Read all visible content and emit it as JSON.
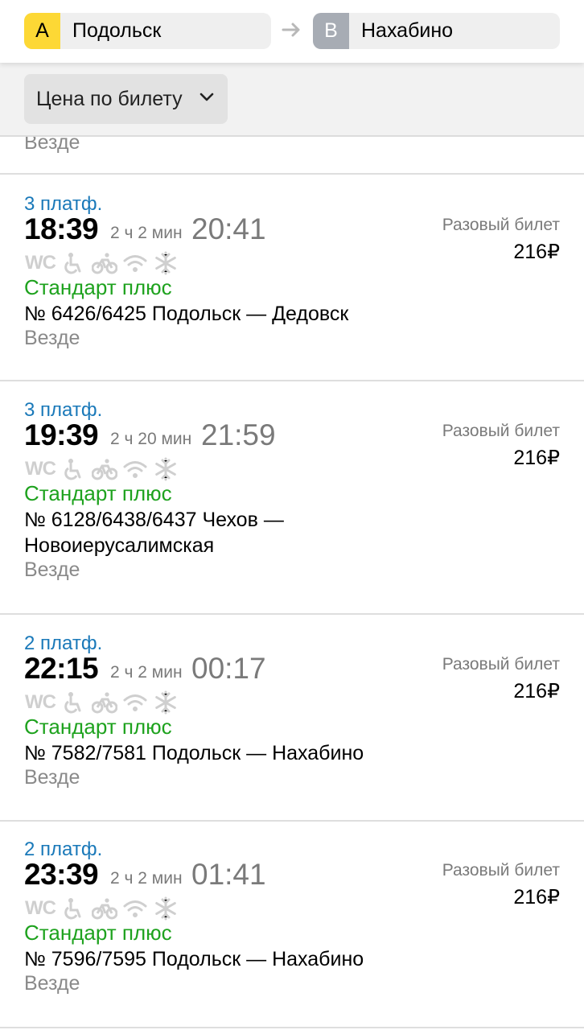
{
  "route": {
    "from_badge": "A",
    "from": "Подольск",
    "to_badge": "B",
    "to": "Нахабино"
  },
  "filter": {
    "label": "Цена по билету"
  },
  "prev_days": "Везде",
  "trips": [
    {
      "platform": "3 платф.",
      "departure": "18:39",
      "duration": "2 ч 2 мин",
      "arrival": "20:41",
      "wc": "WC",
      "class": "Стандарт плюс",
      "route": "№ 6426/6425 Подольск — Дедовск",
      "days": "Везде",
      "ticket": "Разовый билет",
      "price": "216₽"
    },
    {
      "platform": "3 платф.",
      "departure": "19:39",
      "duration": "2 ч 20 мин",
      "arrival": "21:59",
      "wc": "WC",
      "class": "Стандарт плюс",
      "route": "№ 6128/6438/6437 Чехов — Новоиерусалимская",
      "days": "Везде",
      "ticket": "Разовый билет",
      "price": "216₽"
    },
    {
      "platform": "2 платф.",
      "departure": "22:15",
      "duration": "2 ч 2 мин",
      "arrival": "00:17",
      "wc": "WC",
      "class": "Стандарт плюс",
      "route": "№ 7582/7581 Подольск — Нахабино",
      "days": "Везде",
      "ticket": "Разовый билет",
      "price": "216₽"
    },
    {
      "platform": "2 платф.",
      "departure": "23:39",
      "duration": "2 ч 2 мин",
      "arrival": "01:41",
      "wc": "WC",
      "class": "Стандарт плюс",
      "route": "№ 7596/7595 Подольск — Нахабино",
      "days": "Везде",
      "ticket": "Разовый билет",
      "price": "216₽"
    }
  ],
  "colors": {
    "platform": "#1a79b9",
    "class": "#1ea21e",
    "muted": "#7a7a7a",
    "icon": "#cfcfcf"
  }
}
